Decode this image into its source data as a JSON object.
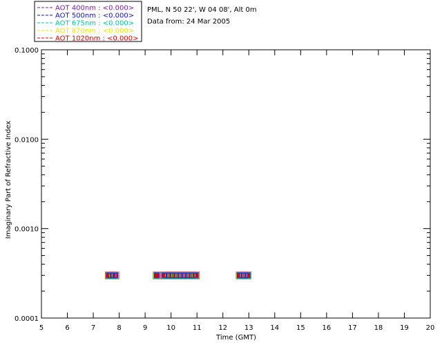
{
  "info": {
    "line1": "PML, N 50 22', W 04 08', Alt 0m",
    "line2": "Data from: 24 Mar 2005"
  },
  "legend": [
    {
      "label": "AOT  400nm : <0.000>",
      "color": "#7a1fa2"
    },
    {
      "label": "AOT  500nm : <0.000>",
      "color": "#1010cc"
    },
    {
      "label": "AOT  675nm : <0.000>",
      "color": "#00c8a0"
    },
    {
      "label": "AOT  870nm : <0.000>",
      "color": "#e8e800"
    },
    {
      "label": "AOT 1020nm : <0.000>",
      "color": "#dd0000"
    }
  ],
  "chart_data": {
    "type": "scatter",
    "xlabel": "Time (GMT)",
    "ylabel": "Imaginary Part of Refractive Index",
    "xlim": [
      5,
      20
    ],
    "ylim": [
      0.0001,
      0.1
    ],
    "yscale": "log",
    "xticks": [
      5,
      6,
      7,
      8,
      9,
      10,
      11,
      12,
      13,
      14,
      15,
      16,
      17,
      18,
      19,
      20
    ],
    "yticks": [
      {
        "value": 0.0001,
        "label": "0.0001"
      },
      {
        "value": 0.001,
        "label": "0.0010"
      },
      {
        "value": 0.01,
        "label": "0.0100"
      },
      {
        "value": 0.1,
        "label": "0.1000"
      }
    ],
    "grid": false,
    "legend_position": "top-left",
    "series": [
      {
        "name": "AOT  400nm : <0.000>",
        "color": "#7a1fa2",
        "x": [
          7.6,
          7.75,
          7.85,
          9.45,
          9.75,
          9.9,
          10.05,
          10.2,
          10.35,
          10.5,
          10.65,
          10.8,
          10.95,
          12.65,
          12.8,
          12.95
        ],
        "y": [
          0.0003,
          0.0003,
          0.0003,
          0.0003,
          0.0003,
          0.0003,
          0.0003,
          0.0003,
          0.0003,
          0.0003,
          0.0003,
          0.0003,
          0.0003,
          0.0003,
          0.0003,
          0.0003
        ]
      },
      {
        "name": "AOT  500nm : <0.000>",
        "color": "#1010cc",
        "x": [
          7.6,
          7.75,
          7.85,
          9.45,
          9.75,
          9.9,
          10.05,
          10.2,
          10.35,
          10.5,
          10.65,
          10.8,
          10.95,
          12.65,
          12.8,
          12.95
        ],
        "y": [
          0.0003,
          0.0003,
          0.0003,
          0.0003,
          0.0003,
          0.0003,
          0.0003,
          0.0003,
          0.0003,
          0.0003,
          0.0003,
          0.0003,
          0.0003,
          0.0003,
          0.0003,
          0.0003
        ]
      },
      {
        "name": "AOT  675nm : <0.000>",
        "color": "#00c8a0",
        "x": [
          7.6,
          7.75,
          7.85,
          9.45,
          9.75,
          9.9,
          10.05,
          10.2,
          10.35,
          10.5,
          10.65,
          10.8,
          10.95,
          12.65,
          12.8,
          12.95
        ],
        "y": [
          0.0003,
          0.0003,
          0.0003,
          0.0003,
          0.0003,
          0.0003,
          0.0003,
          0.0003,
          0.0003,
          0.0003,
          0.0003,
          0.0003,
          0.0003,
          0.0003,
          0.0003,
          0.0003
        ]
      },
      {
        "name": "AOT  870nm : <0.000>",
        "color": "#e8e800",
        "x": [
          7.6,
          7.75,
          7.85,
          9.45,
          9.75,
          9.9,
          10.05,
          10.2,
          10.35,
          10.5,
          10.65,
          10.8,
          10.95,
          12.65,
          12.8,
          12.95
        ],
        "y": [
          0.0003,
          0.0003,
          0.0003,
          0.0003,
          0.0003,
          0.0003,
          0.0003,
          0.0003,
          0.0003,
          0.0003,
          0.0003,
          0.0003,
          0.0003,
          0.0003,
          0.0003,
          0.0003
        ]
      },
      {
        "name": "AOT 1020nm : <0.000>",
        "color": "#dd0000",
        "x": [
          7.6,
          7.75,
          7.85,
          9.45,
          9.75,
          9.9,
          10.05,
          10.2,
          10.35,
          10.5,
          10.65,
          10.8,
          10.95,
          12.65,
          12.8,
          12.95
        ],
        "y": [
          0.0003,
          0.0003,
          0.0003,
          0.0003,
          0.0003,
          0.0003,
          0.0003,
          0.0003,
          0.0003,
          0.0003,
          0.0003,
          0.0003,
          0.0003,
          0.0003,
          0.0003,
          0.0003
        ]
      }
    ]
  }
}
